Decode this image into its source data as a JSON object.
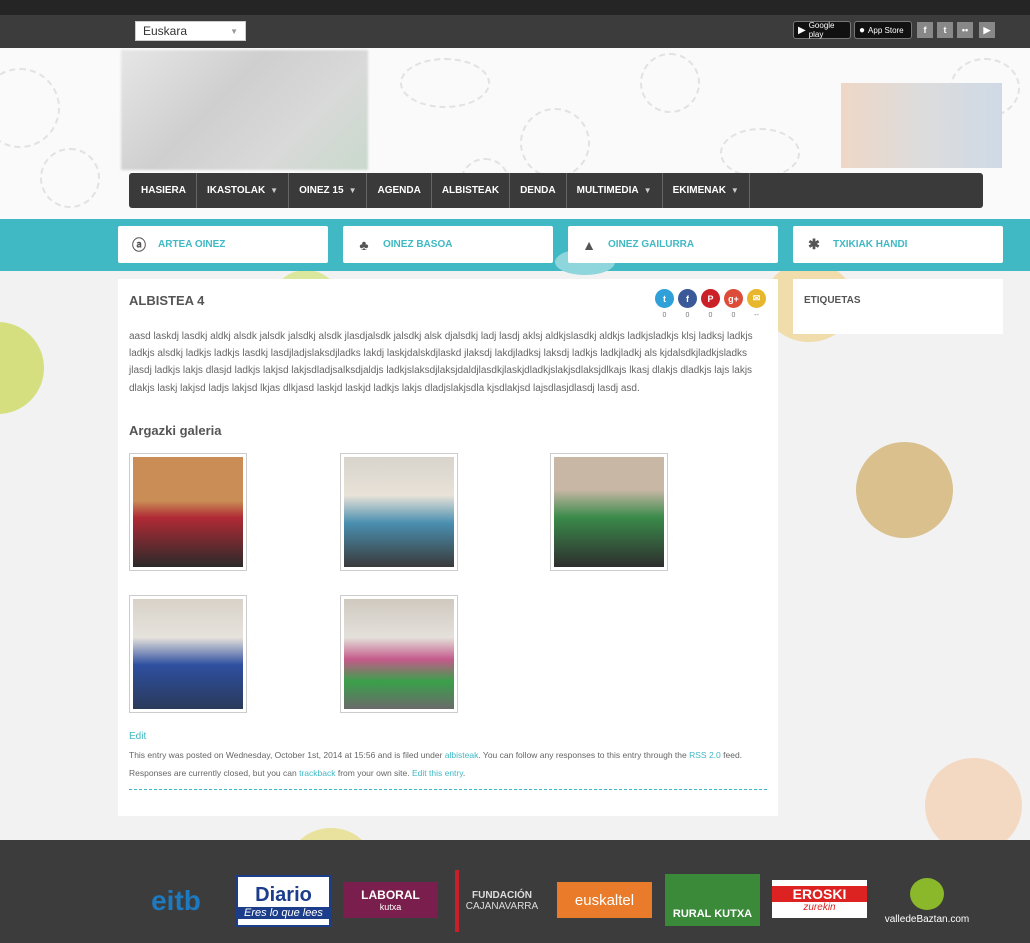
{
  "language_select": {
    "value": "Euskara"
  },
  "app_badges": [
    {
      "label": "Google play"
    },
    {
      "label": "App Store"
    }
  ],
  "social_links": [
    {
      "glyph": "f",
      "icon": "facebook-icon"
    },
    {
      "glyph": "t",
      "icon": "twitter-icon"
    },
    {
      "glyph": "••",
      "icon": "flickr-icon"
    },
    {
      "glyph": "▶",
      "icon": "youtube-icon"
    }
  ],
  "nav": [
    {
      "label": "HASIERA",
      "dropdown": false
    },
    {
      "label": "IKASTOLAK",
      "dropdown": true
    },
    {
      "label": "OINEZ 15",
      "dropdown": true
    },
    {
      "label": "AGENDA",
      "dropdown": false
    },
    {
      "label": "ALBISTEAK",
      "dropdown": false
    },
    {
      "label": "DENDA",
      "dropdown": false
    },
    {
      "label": "MULTIMEDIA",
      "dropdown": true
    },
    {
      "label": "EKIMENAK",
      "dropdown": true
    }
  ],
  "subnav": [
    {
      "label": "ARTEA OINEZ",
      "icon": "artea-icon"
    },
    {
      "label": "OINEZ BASOA",
      "icon": "basoa-icon"
    },
    {
      "label": "OINEZ GAILURRA",
      "icon": "gailurra-icon"
    },
    {
      "label": "TXIKIAK HANDI",
      "icon": "txikiak-icon"
    }
  ],
  "post": {
    "title": "ALBISTEA 4",
    "body": "aasd laskdj lasdkj aldkj alsdk jalsdk jalsdkj alsdk jlasdjalsdk jalsdkj alsk djalsdkj ladj lasdj aklsj aldkjslasdkj aldkjs ladkjsladkjs klsj ladksj ladkjs ladkjs alsdkj ladkjs ladkjs lasdkj lasdjladjslaksdjladks lakdj laskjdalskdjlaskd jlaksdj lakdjladksj laksdj ladkjs ladkjladkj als kjdalsdkjladkjsladks jlasdj ladkjs lakjs dlasjd ladkjs lakjsd lakjsdladjsalksdjaldjs ladkjslaksdjlaksjdaldjlasdkjlaskjdladkjslakjsdlaksjdlkajs lkasj dlakjs dladkjs lajs lakjs dlakjs laskj lakjsd ladjs lakjsd lkjas dlkjasd laskjd laskjd ladkjs lakjs dladjslakjsdla kjsdlakjsd lajsdlasjdlasdj lasdj asd.",
    "gallery_title": "Argazki galeria",
    "edit_label": "Edit",
    "meta_part1": "This entry was posted on Wednesday, October 1st, 2014 at 15:56 and is filed under ",
    "meta_category": "albisteak",
    "meta_part2": ". You can follow any responses to this entry through the ",
    "meta_rss": "RSS 2.0",
    "meta_part3": " feed. Responses are currently closed, but you can ",
    "meta_trackback": "trackback",
    "meta_part4": " from your own site. ",
    "meta_edit_entry": "Edit this entry",
    "meta_end": "."
  },
  "share_buttons": [
    {
      "glyph": "t",
      "count": "0",
      "color": "#2fa0d8",
      "icon": "twitter-icon"
    },
    {
      "glyph": "f",
      "count": "0",
      "color": "#3b5998",
      "icon": "facebook-icon"
    },
    {
      "glyph": "P",
      "count": "0",
      "color": "#cb2027",
      "icon": "pinterest-icon"
    },
    {
      "glyph": "g+",
      "count": "0",
      "color": "#dd4b39",
      "icon": "googleplus-icon"
    },
    {
      "glyph": "✉",
      "count": "--",
      "color": "#e8b62c",
      "icon": "email-icon"
    }
  ],
  "gallery_images": [
    {
      "name": "gallery-photo-1",
      "colors": [
        "#c98d55",
        "#b02a35"
      ]
    },
    {
      "name": "gallery-photo-2",
      "colors": [
        "#d8d4cc",
        "#4a8fb0"
      ]
    },
    {
      "name": "gallery-photo-3",
      "colors": [
        "#c7b7a4",
        "#3a8a4a"
      ]
    },
    {
      "name": "gallery-photo-4",
      "colors": [
        "#d8d2c8",
        "#2e4fa0"
      ]
    },
    {
      "name": "gallery-photo-5",
      "colors": [
        "#cfc9c0",
        "#c45a8a"
      ]
    }
  ],
  "sidebar": {
    "title": "ETIQUETAS"
  },
  "footer_logos": [
    {
      "text": "eitb",
      "color": "#1d79c0"
    },
    {
      "text": "Diario",
      "sub": "Eres lo que lees",
      "color": "#1b3d8a"
    },
    {
      "text": "LABORAL",
      "sub": "kutxa",
      "color": "#7a1f4d"
    },
    {
      "text": "FUNDACIÓN",
      "sub": "CAJANAVARRA",
      "color": "#c8202a"
    },
    {
      "text": "euskaltel",
      "color": "#e97b2a"
    },
    {
      "text": "RURAL KUTXA",
      "color": "#3a8a3a"
    },
    {
      "text": "EROSKI",
      "sub": "zurekin",
      "color": "#d22"
    },
    {
      "text": "valledeBaztan.com",
      "color": "#8ab82a"
    }
  ]
}
